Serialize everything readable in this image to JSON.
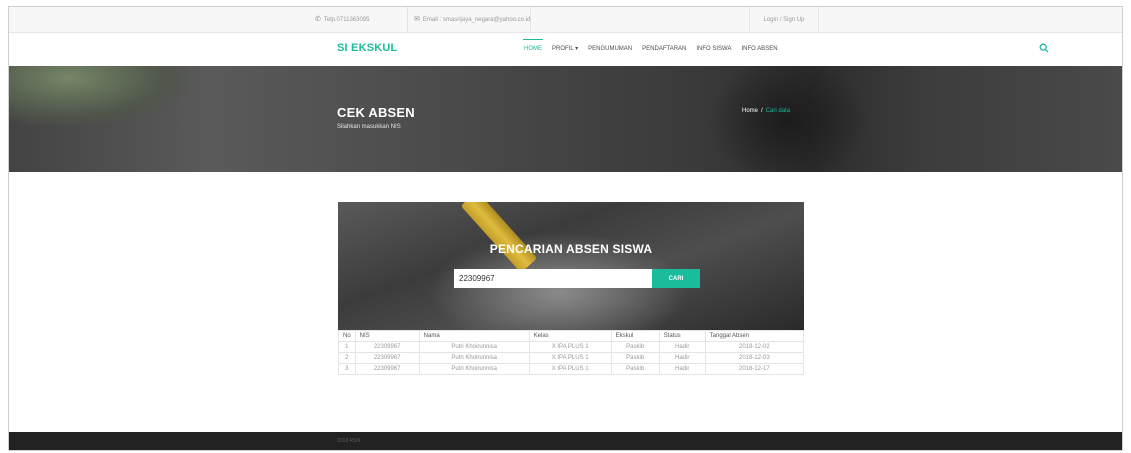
{
  "topbar": {
    "phone": "Telp.0711363095",
    "email": "Email : smasrijaya_negara@yahoo.co.id",
    "login": "Login / Sign Up"
  },
  "navbar": {
    "brand": "SI EKSKUL",
    "items": [
      {
        "label": "HOME",
        "active": true
      },
      {
        "label": "PROFIL ▾",
        "active": false
      },
      {
        "label": "PENGUMUMAN",
        "active": false
      },
      {
        "label": "PENDAFTARAN",
        "active": false
      },
      {
        "label": "INFO SISWA",
        "active": false
      },
      {
        "label": "INFO ABSEN",
        "active": false
      }
    ],
    "search_icon": "search-icon"
  },
  "hero": {
    "title": "CEK ABSEN",
    "subtitle": "Silahkan masukkan NIS",
    "breadcrumb": {
      "home": "Home",
      "sep": "/",
      "current": "Cari data"
    }
  },
  "search": {
    "title": "PENCARIAN ABSEN SISWA",
    "value": "22309967",
    "button": "CARI"
  },
  "table": {
    "headers": [
      "No",
      "NIS",
      "Nama",
      "Kelas",
      "Ekskul",
      "Status",
      "Tanggal Absen"
    ],
    "rows": [
      [
        "1",
        "22309967",
        "Putri Khoirunnisa",
        "X IPA PLUS 1",
        "Paskib",
        "Hadir",
        "2018-12-02"
      ],
      [
        "2",
        "22309967",
        "Putri Khoirunnisa",
        "X IPA PLUS 1",
        "Paskib",
        "Hadir",
        "2018-12-03"
      ],
      [
        "3",
        "22309967",
        "Putri Khoirunnisa",
        "X IPA PLUS 1",
        "Paskib",
        "Hadir",
        "2018-12-17"
      ]
    ]
  },
  "footer": {
    "text": "2018 RSN"
  },
  "colors": {
    "accent": "#1abc9c",
    "footer": "#222222"
  }
}
